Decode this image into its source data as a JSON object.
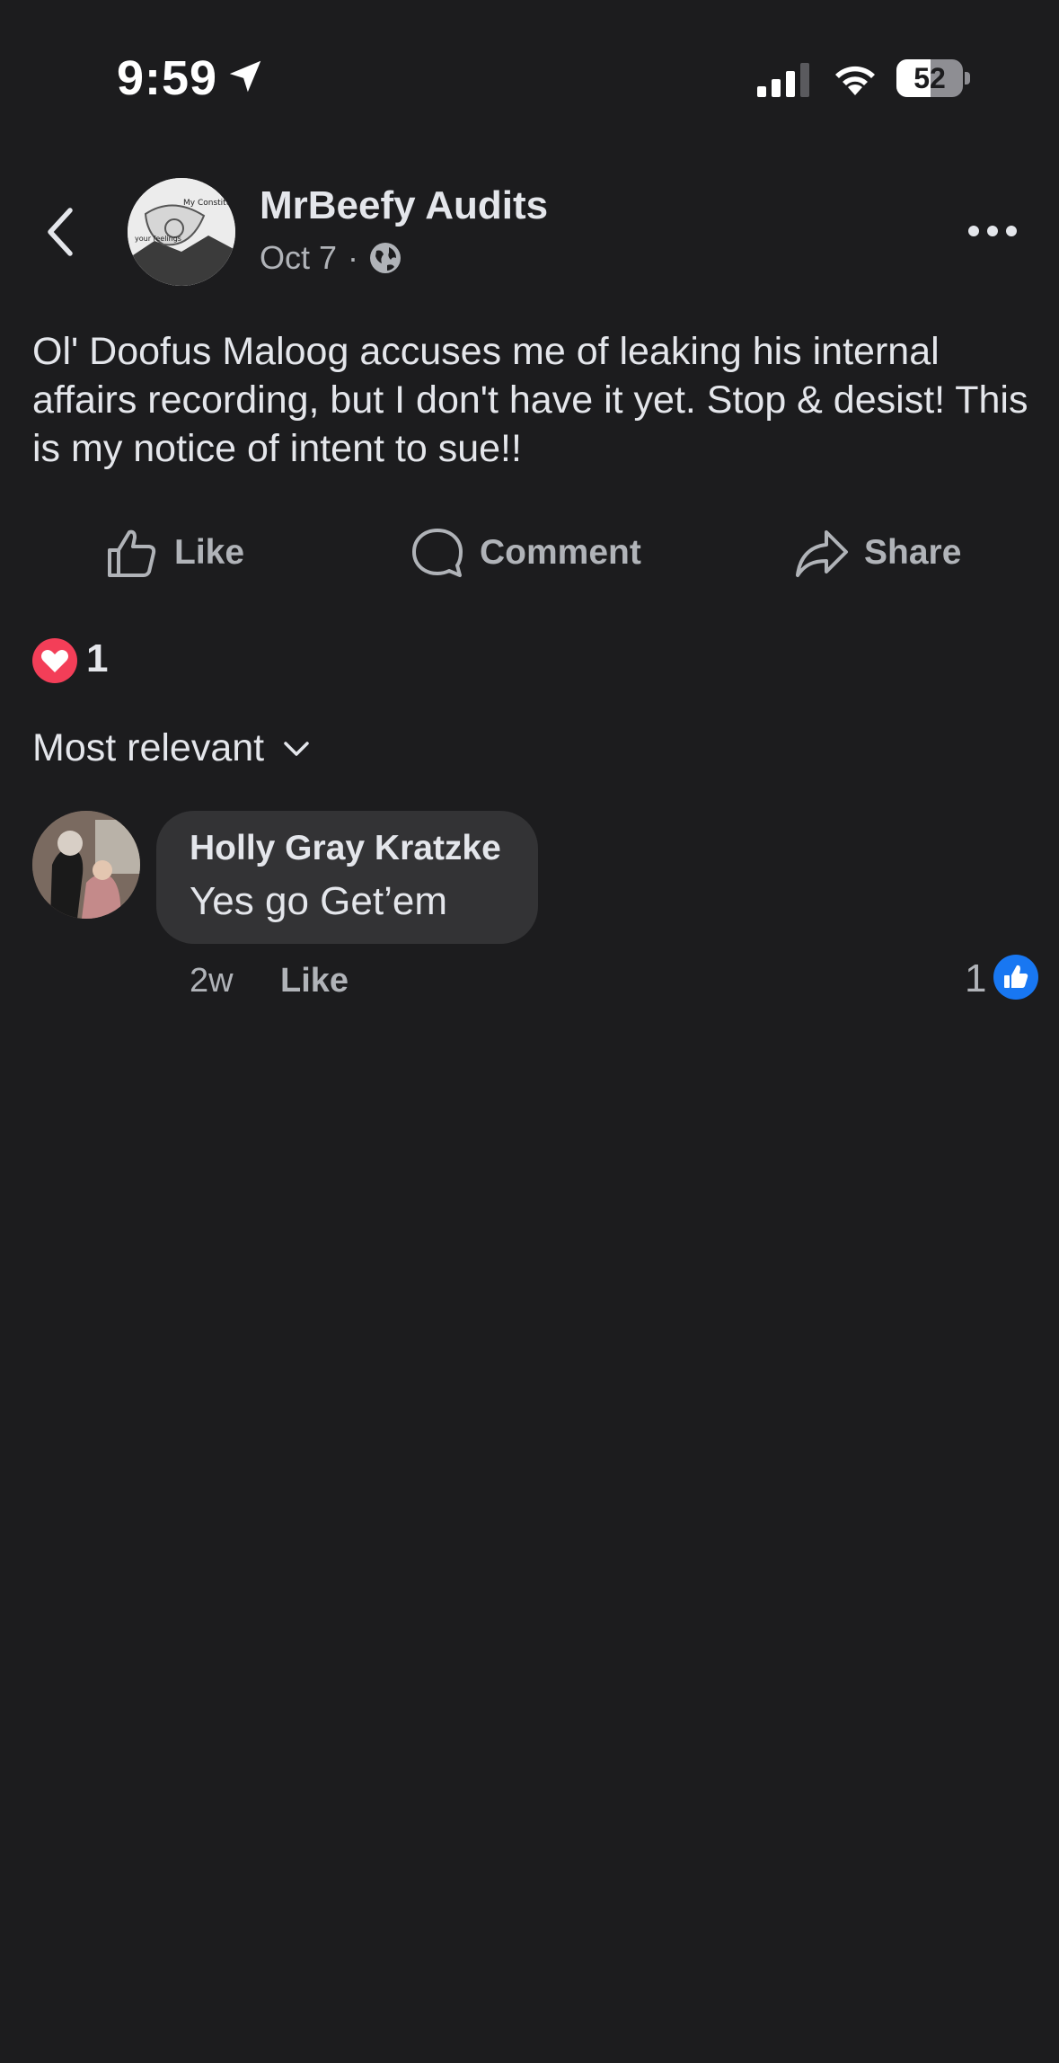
{
  "status_bar": {
    "time": "9:59",
    "battery": "52",
    "battery_level": 0.52,
    "icons": [
      "location-arrow-icon",
      "cellular-signal-icon",
      "wifi-icon",
      "battery-icon"
    ]
  },
  "header": {
    "page_name": "MrBeefy Audits",
    "date": "Oct 7",
    "separator": "·",
    "privacy_icon": "globe-icon",
    "avatar_texts": [
      "My Constitutional Rights",
      "your feelings"
    ]
  },
  "post": {
    "text": "Ol' Doofus Maloog accuses me of leaking his internal affairs recording, but I don't have it yet. Stop & desist! This is my notice of intent to sue!!"
  },
  "actions": {
    "like": "Like",
    "comment": "Comment",
    "share": "Share"
  },
  "reactions": {
    "count": "1",
    "type_icon": "heart-reaction-icon",
    "color": "#f33e58"
  },
  "sort": {
    "label": "Most relevant"
  },
  "comments": [
    {
      "author": "Holly Gray Kratzke",
      "text": "Yes go Get’em",
      "time": "2w",
      "like_label": "Like",
      "like_count": "1"
    }
  ],
  "colors": {
    "background": "#1c1c1e",
    "bubble": "#333335",
    "primary_text": "#e4e6eb",
    "secondary_text": "#b0b3b8",
    "accent_blue": "#1877f2"
  }
}
